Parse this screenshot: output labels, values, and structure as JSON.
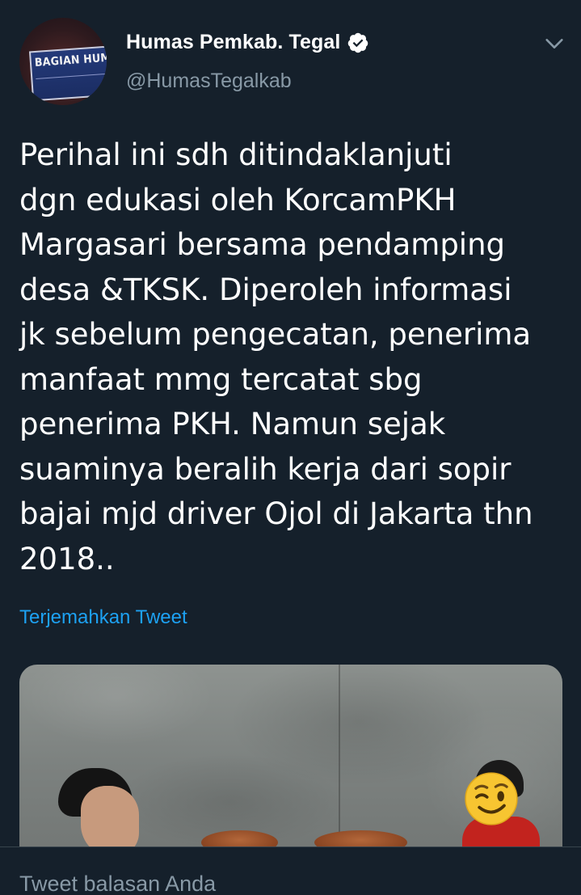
{
  "author": {
    "display_name": "Humas Pemkab. Tegal",
    "handle": "@HumasTegalkab",
    "avatar_sign_text": "BAGIAN HUMAS",
    "verified": true
  },
  "tweet": {
    "lines": [
      "Perihal ini sdh ditindaklanjuti",
      "dgn edukasi oleh KorcamPKH",
      "Margasari bersama pendamping",
      "desa &TKSK. Diperoleh informasi",
      "jk sebelum pengecatan, penerima",
      "manfaat mmg tercatat sbg",
      "penerima PKH. Namun sejak",
      "suaminya beralih kerja dari sopir",
      "bajai mjd driver Ojol di Jakarta thn",
      "2018.."
    ],
    "translate_label": "Terjemahkan Tweet"
  },
  "reply": {
    "placeholder": "Tweet balasan Anda"
  },
  "icons": {
    "verified": "verified-badge-icon",
    "caret": "chevron-down-icon",
    "emoji": "winking-face-emoji"
  },
  "colors": {
    "background": "#15202b",
    "link": "#1da1f2",
    "secondary_text": "#8899a6",
    "divider": "#38444d"
  }
}
